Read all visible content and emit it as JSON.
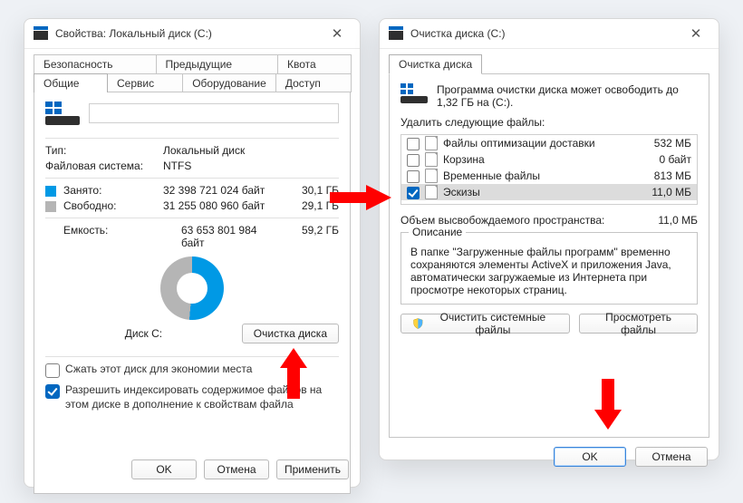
{
  "prop": {
    "title": "Свойства: Локальный диск (C:)",
    "tabs_row1": [
      "Безопасность",
      "Предыдущие версии",
      "Квота"
    ],
    "tabs_row2": [
      "Общие",
      "Сервис",
      "Оборудование",
      "Доступ"
    ],
    "type_k": "Тип:",
    "type_v": "Локальный диск",
    "fs_k": "Файловая система:",
    "fs_v": "NTFS",
    "used_k": "Занято:",
    "used_bytes": "32 398 721 024 байт",
    "used_gb": "30,1 ГБ",
    "free_k": "Свободно:",
    "free_bytes": "31 255 080 960 байт",
    "free_gb": "29,1 ГБ",
    "cap_k": "Емкость:",
    "cap_bytes": "63 653 801 984 байт",
    "cap_gb": "59,2 ГБ",
    "disk_label": "Диск C:",
    "clean_btn": "Очистка диска",
    "compress": "Сжать этот диск для экономии места",
    "index": "Разрешить индексировать содержимое файлов на этом диске в дополнение к свойствам файла",
    "ok": "OK",
    "cancel": "Отмена",
    "apply": "Применить"
  },
  "clean": {
    "title": "Очистка диска  (C:)",
    "tab": "Очистка диска",
    "free_text": "Программа очистки диска может освободить до 1,32 ГБ на  (C:).",
    "delete_label": "Удалить следующие файлы:",
    "items": [
      {
        "checked": false,
        "name": "Файлы оптимизации доставки",
        "size": "532 МБ",
        "selected": false
      },
      {
        "checked": false,
        "name": "Корзина",
        "size": "0 байт",
        "selected": false
      },
      {
        "checked": false,
        "name": "Временные файлы",
        "size": "813 МБ",
        "selected": false
      },
      {
        "checked": true,
        "name": "Эскизы",
        "size": "11,0 МБ",
        "selected": true
      }
    ],
    "total_k": "Объем высвобождаемого пространства:",
    "total_v": "11,0 МБ",
    "desc_title": "Описание",
    "desc_body": "В папке \"Загруженные файлы программ\" временно сохраняются элементы ActiveX и приложения Java, автоматически загружаемые из Интернета при просмотре некоторых страниц.",
    "sys_btn": "Очистить системные файлы",
    "view_btn": "Просмотреть файлы",
    "ok": "OK",
    "cancel": "Отмена"
  }
}
